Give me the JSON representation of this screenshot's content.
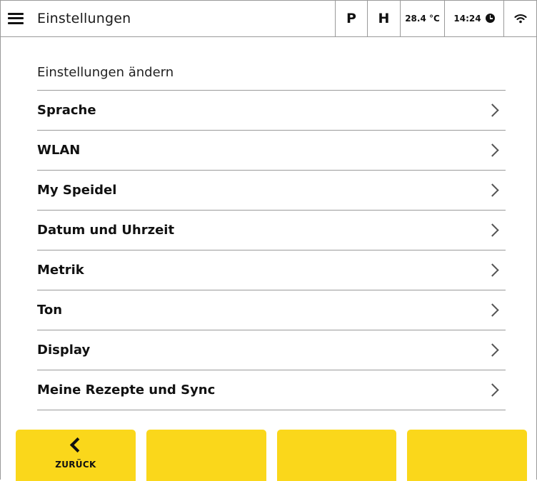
{
  "header": {
    "title": "Einstellungen",
    "status": {
      "p": "P",
      "h": "H",
      "temperature": "28.4 °C",
      "time": "14:24"
    },
    "icons": [
      "hamburger-menu-icon",
      "clock-icon",
      "wifi-icon"
    ]
  },
  "main": {
    "heading": "Einstellungen ändern",
    "items": [
      {
        "label": "Sprache"
      },
      {
        "label": "WLAN"
      },
      {
        "label": "My Speidel"
      },
      {
        "label": "Datum und Uhrzeit"
      },
      {
        "label": "Metrik"
      },
      {
        "label": "Ton"
      },
      {
        "label": "Display"
      },
      {
        "label": "Meine Rezepte und Sync"
      }
    ]
  },
  "bottom_bar": {
    "back_label": "ZURÜCK",
    "button_color": "#fad71b"
  }
}
